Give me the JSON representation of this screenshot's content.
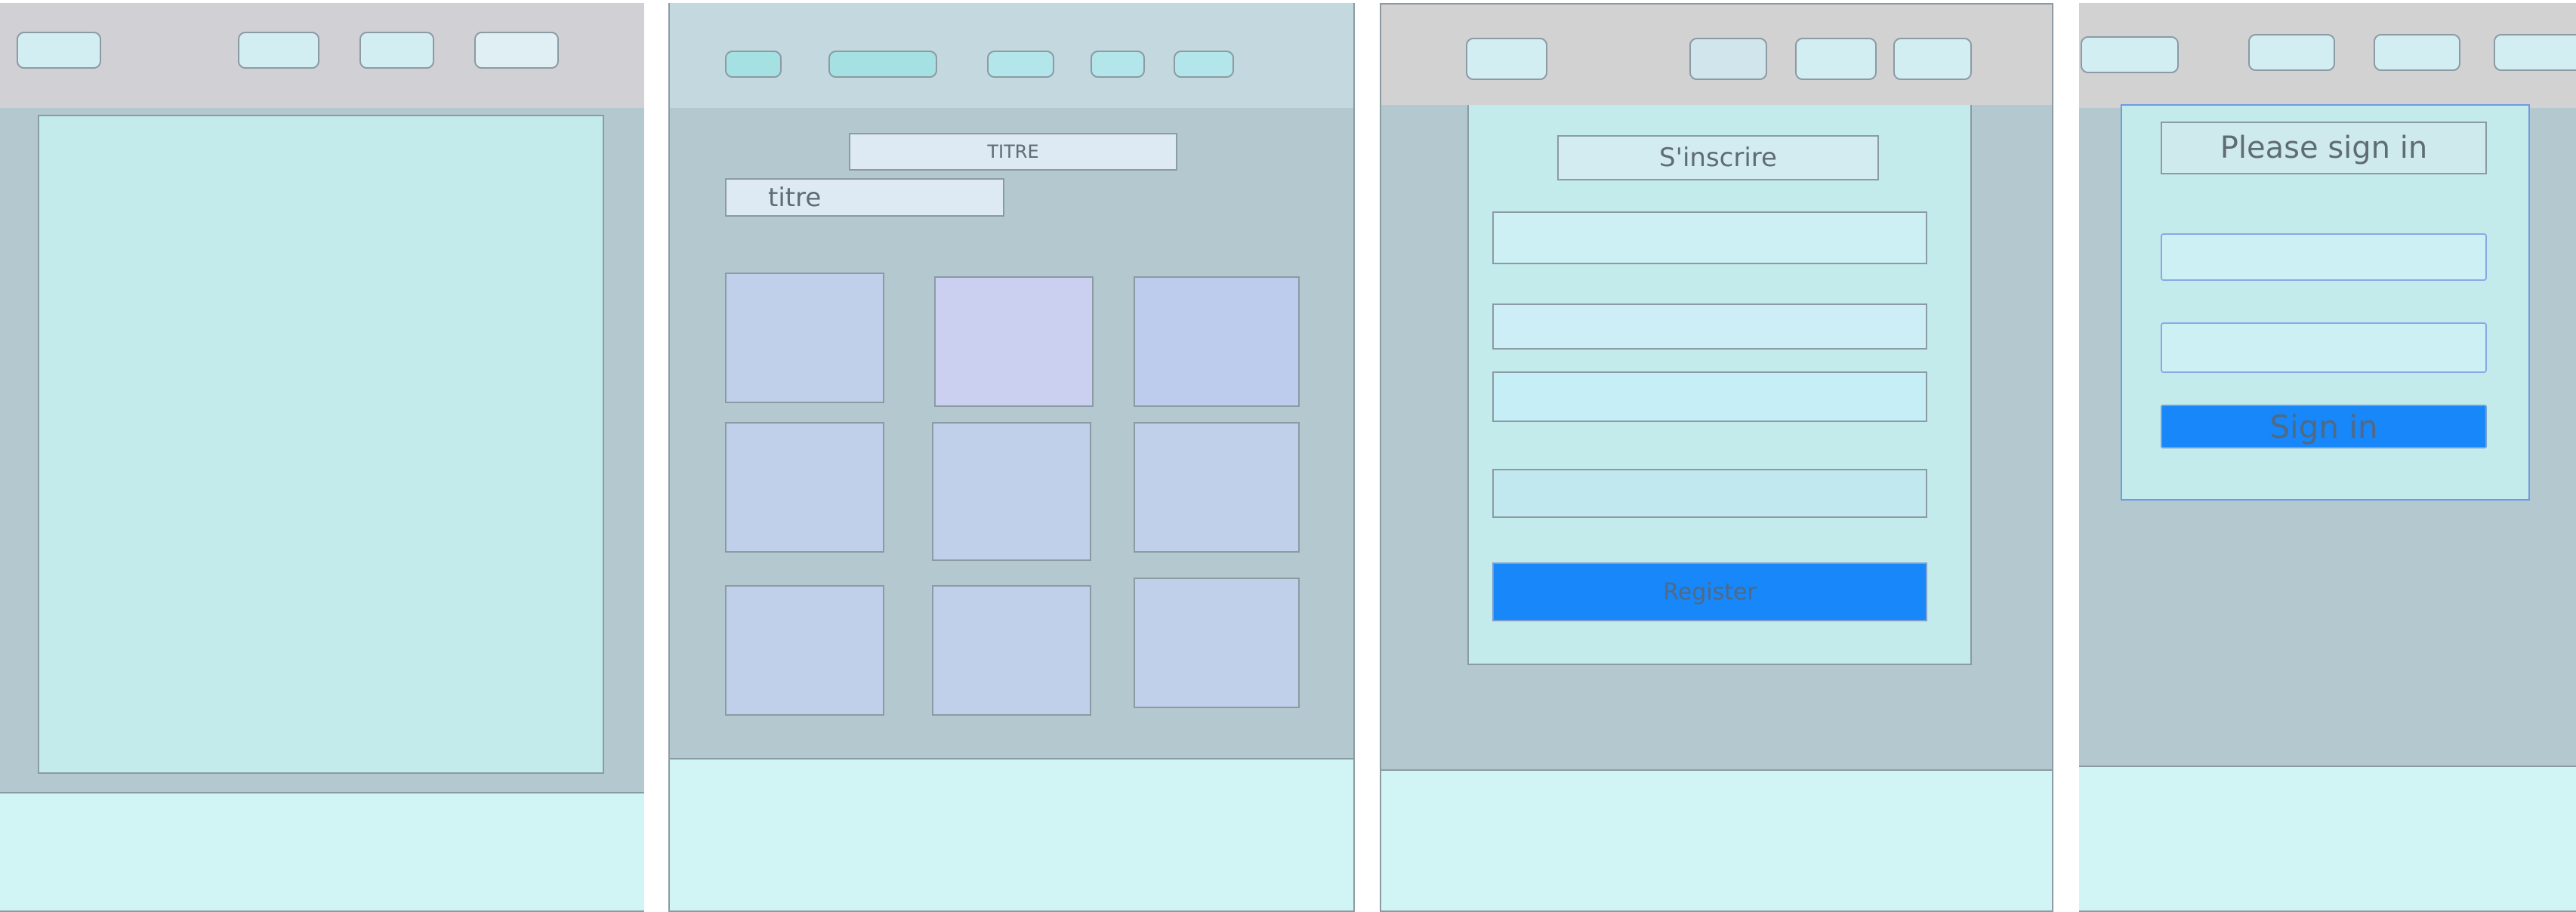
{
  "colors": {
    "nav_grey": "#d1d0d4",
    "nav_blue": "#c3d8df",
    "content_bg": "#b3c8cf",
    "card_bg": "#c3ebeb",
    "footer_bg": "#d1f5f4",
    "tile_bg": "#c1d0ea",
    "button_blue": "#1787f9"
  },
  "frames": [
    {
      "name": "wireframe-blank-page"
    },
    {
      "name": "wireframe-gallery-page",
      "title": "TITRE",
      "subtitle": "titre"
    },
    {
      "name": "wireframe-register-page",
      "title": "S'inscrire",
      "button": "Register"
    },
    {
      "name": "wireframe-signin-page",
      "title": "Please sign in",
      "button": "Sign in"
    }
  ]
}
